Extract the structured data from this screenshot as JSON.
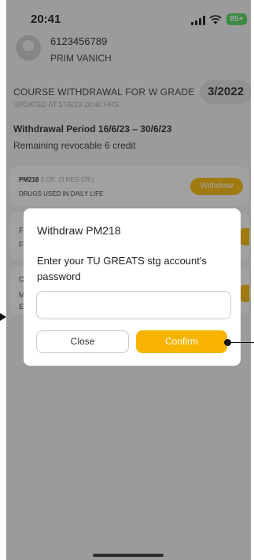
{
  "status_bar": {
    "time": "20:41",
    "battery": "85+"
  },
  "profile": {
    "student_id": "6123456789",
    "name": "PRIM VANICH"
  },
  "header": {
    "title": "COURSE WITHDRAWAL FOR W GRADE",
    "updated": "UPDATED AT 17/6/23 20:40 HRS.",
    "term": "3/2022"
  },
  "period": {
    "label": "Withdrawal Period 16/6/23 – 30/6/23",
    "remaining": "Remaining revocable 6 credit"
  },
  "courses": [
    {
      "code": "PM218",
      "credits": "3 CR. (3 REG CR.)",
      "name": "DRUGS USED IN DAILY LIFE",
      "action": "Withdraw"
    },
    {
      "letter_a": "F",
      "letter_b": "F"
    },
    {
      "letter_a": "C",
      "letter_b": "M",
      "letter_c": "E"
    }
  ],
  "dialog": {
    "title": "Withdraw PM218",
    "prompt": "Enter your TU GREATS stg account's password",
    "password_value": "",
    "close_label": "Close",
    "confirm_label": "Confirm"
  },
  "colors": {
    "accent": "#f8b400",
    "battery": "#4ad25b",
    "overlay": "rgba(40,40,40,0.42)"
  }
}
